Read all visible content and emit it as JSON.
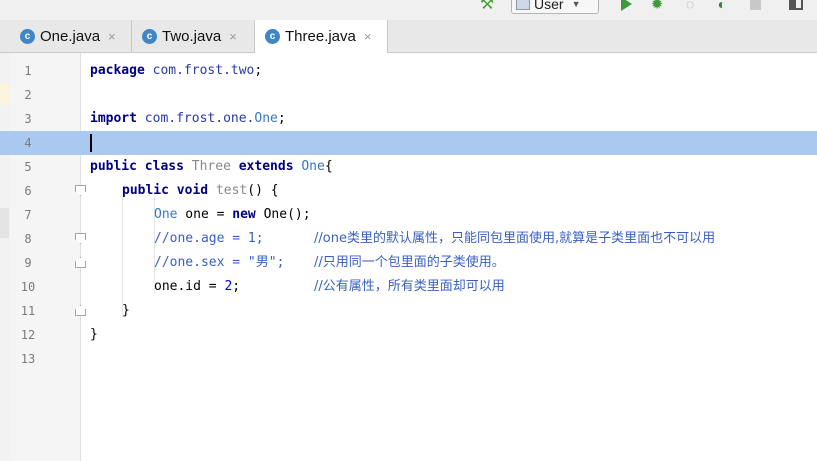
{
  "toolbar": {
    "run_config": {
      "label": "User"
    },
    "icons": [
      "build-icon",
      "run-icon",
      "debug-icon",
      "coverage-icon",
      "profile-icon",
      "stop-icon",
      "layout-icon"
    ]
  },
  "tabs": [
    {
      "icon_letter": "c",
      "label": "One.java",
      "close": "×",
      "active": false
    },
    {
      "icon_letter": "c",
      "label": "Two.java",
      "close": "×",
      "active": false
    },
    {
      "icon_letter": "c",
      "label": "Three.java",
      "close": "×",
      "active": true
    }
  ],
  "editor": {
    "current_line": 4,
    "lines": [
      {
        "n": "1"
      },
      {
        "n": "2"
      },
      {
        "n": "3"
      },
      {
        "n": "4"
      },
      {
        "n": "5"
      },
      {
        "n": "6"
      },
      {
        "n": "7"
      },
      {
        "n": "8"
      },
      {
        "n": "9"
      },
      {
        "n": "10"
      },
      {
        "n": "11"
      },
      {
        "n": "12"
      },
      {
        "n": "13"
      }
    ],
    "tokens": {
      "l1_kw": "package",
      "l1_pkg": "com.frost.two",
      "l1_semi": ";",
      "l3_kw": "import",
      "l3_pkg": "com.frost.one.",
      "l3_cls": "One",
      "l3_semi": ";",
      "l5_kw1": "public",
      "l5_kw2": "class",
      "l5_name": "Three",
      "l5_kw3": "extends",
      "l5_cls": "One",
      "l5_brace": "{",
      "l6_kw1": "public",
      "l6_kw2": "void",
      "l6_name": "test",
      "l6_rest": "() {",
      "l7_cls": "One",
      "l7_var": " one = ",
      "l7_kw": "new",
      "l7_rest": " One();",
      "l8_code": "//one.age = 1;",
      "l8_comment": "//one类里的默认属性，只能同包里面使用,就算是子类里面也不可以用",
      "l9_code_a": "//one.sex = ",
      "l9_code_b": "\"男\";",
      "l9_comment": "//只用同一个包里面的子类使用。",
      "l10_code_a": "one.id = ",
      "l10_num": "2",
      "l10_code_b": ";",
      "l10_comment": "//公有属性，所有类里面却可以用",
      "l11_brace": "}",
      "l12_brace": "}"
    }
  }
}
